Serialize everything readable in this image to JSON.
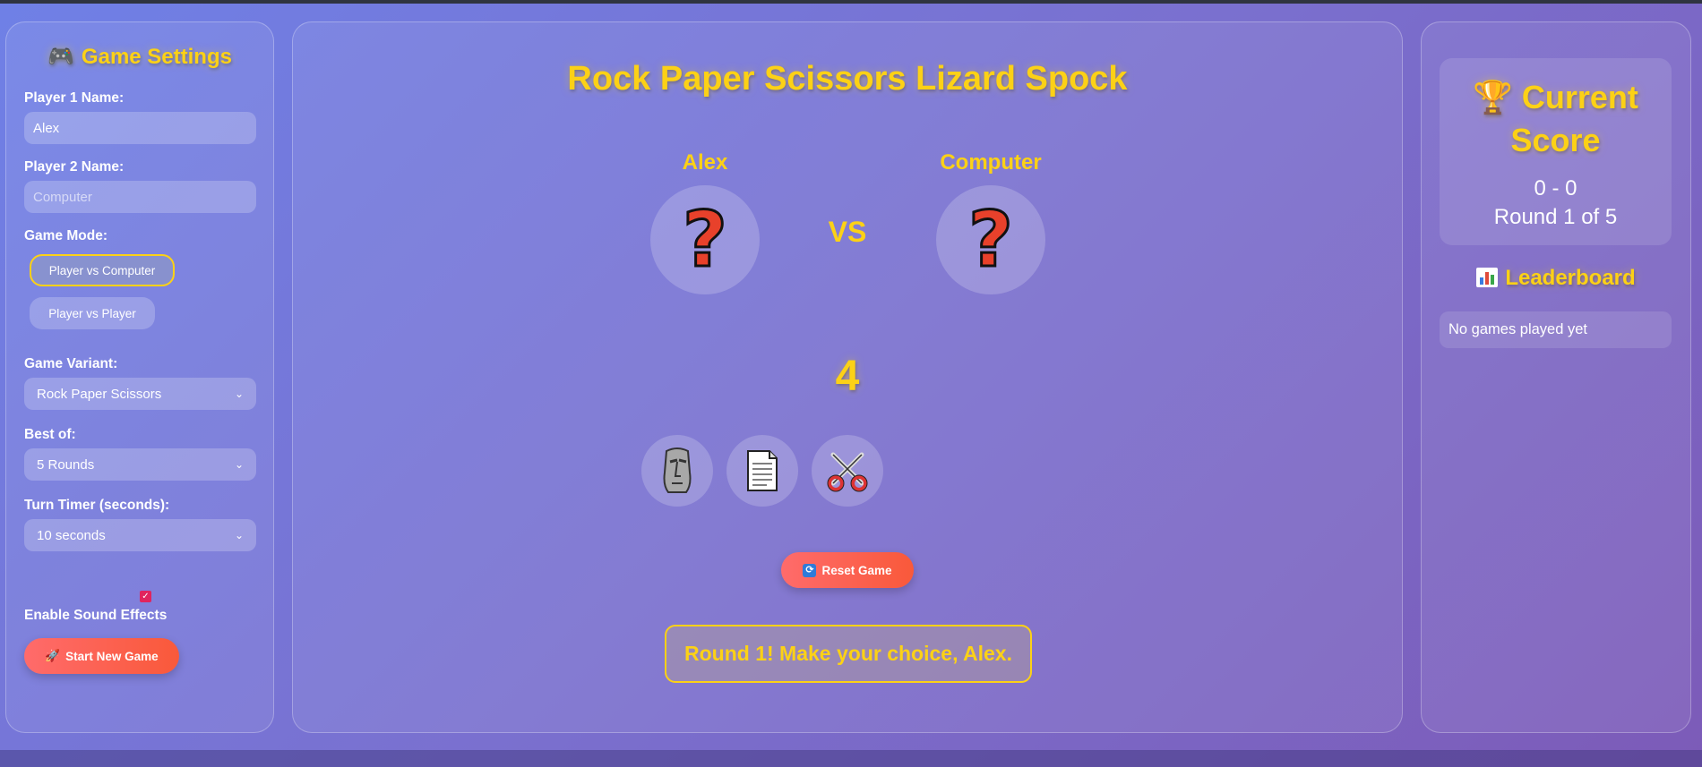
{
  "settings": {
    "title": "Game Settings",
    "title_icon": "gamepad-icon",
    "player1_label": "Player 1 Name:",
    "player1_value": "Alex",
    "player2_label": "Player 2 Name:",
    "player2_placeholder": "Computer",
    "mode_label": "Game Mode:",
    "modes": [
      "Player vs Computer",
      "Player vs Player"
    ],
    "active_mode": "Player vs Computer",
    "variant_label": "Game Variant:",
    "variant_value": "Rock Paper Scissors",
    "bestof_label": "Best of:",
    "bestof_value": "5 Rounds",
    "timer_label": "Turn Timer (seconds):",
    "timer_value": "10 seconds",
    "sound_label": "Enable Sound Effects",
    "sound_enabled": true,
    "start_label": "Start New Game"
  },
  "game": {
    "title": "Rock Paper Scissors Lizard Spock",
    "player1_name": "Alex",
    "player2_name": "Computer",
    "player1_choice": "?",
    "player2_choice": "?",
    "vs_label": "VS",
    "countdown": "4",
    "options": [
      "rock-moai-icon",
      "paper-page-icon",
      "scissors-icon"
    ],
    "reset_label": "Reset Game",
    "status": "Round 1! Make your choice, Alex."
  },
  "score": {
    "title": "Current Score",
    "value": "0 - 0",
    "round": "Round 1 of 5",
    "leaderboard_title": "Leaderboard",
    "leaderboard_empty": "No games played yet"
  },
  "colors": {
    "accent": "#fcd116",
    "button": "#f9593a",
    "question": "#e8412b"
  }
}
